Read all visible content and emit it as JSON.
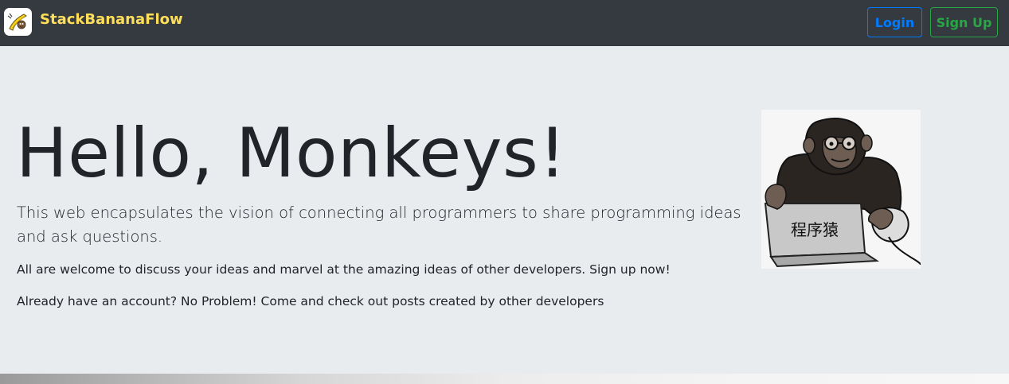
{
  "navbar": {
    "brand_name": "StackBananaFlow",
    "logo_icon": "banana-monkey-logo-icon",
    "login_label": "Login",
    "signup_label": "Sign Up"
  },
  "hero": {
    "title": "Hello, Monkeys!",
    "lead": "This web encapsulates the vision of connecting all programmers to share programming ideas and ask questions.",
    "text1": "All are welcome to discuss your ideas and marvel at the amazing ideas of other developers. Sign up now!",
    "text2": "Already have an account? No Problem! Come and check out posts created by other developers",
    "image": {
      "icon": "monkey-programmer-image",
      "laptop_text": "程序猿"
    }
  },
  "colors": {
    "navbar_bg": "#343a40",
    "brand": "#ffdf5a",
    "login": "#007bff",
    "signup": "#28a745",
    "page_bg": "#e9ecef"
  }
}
